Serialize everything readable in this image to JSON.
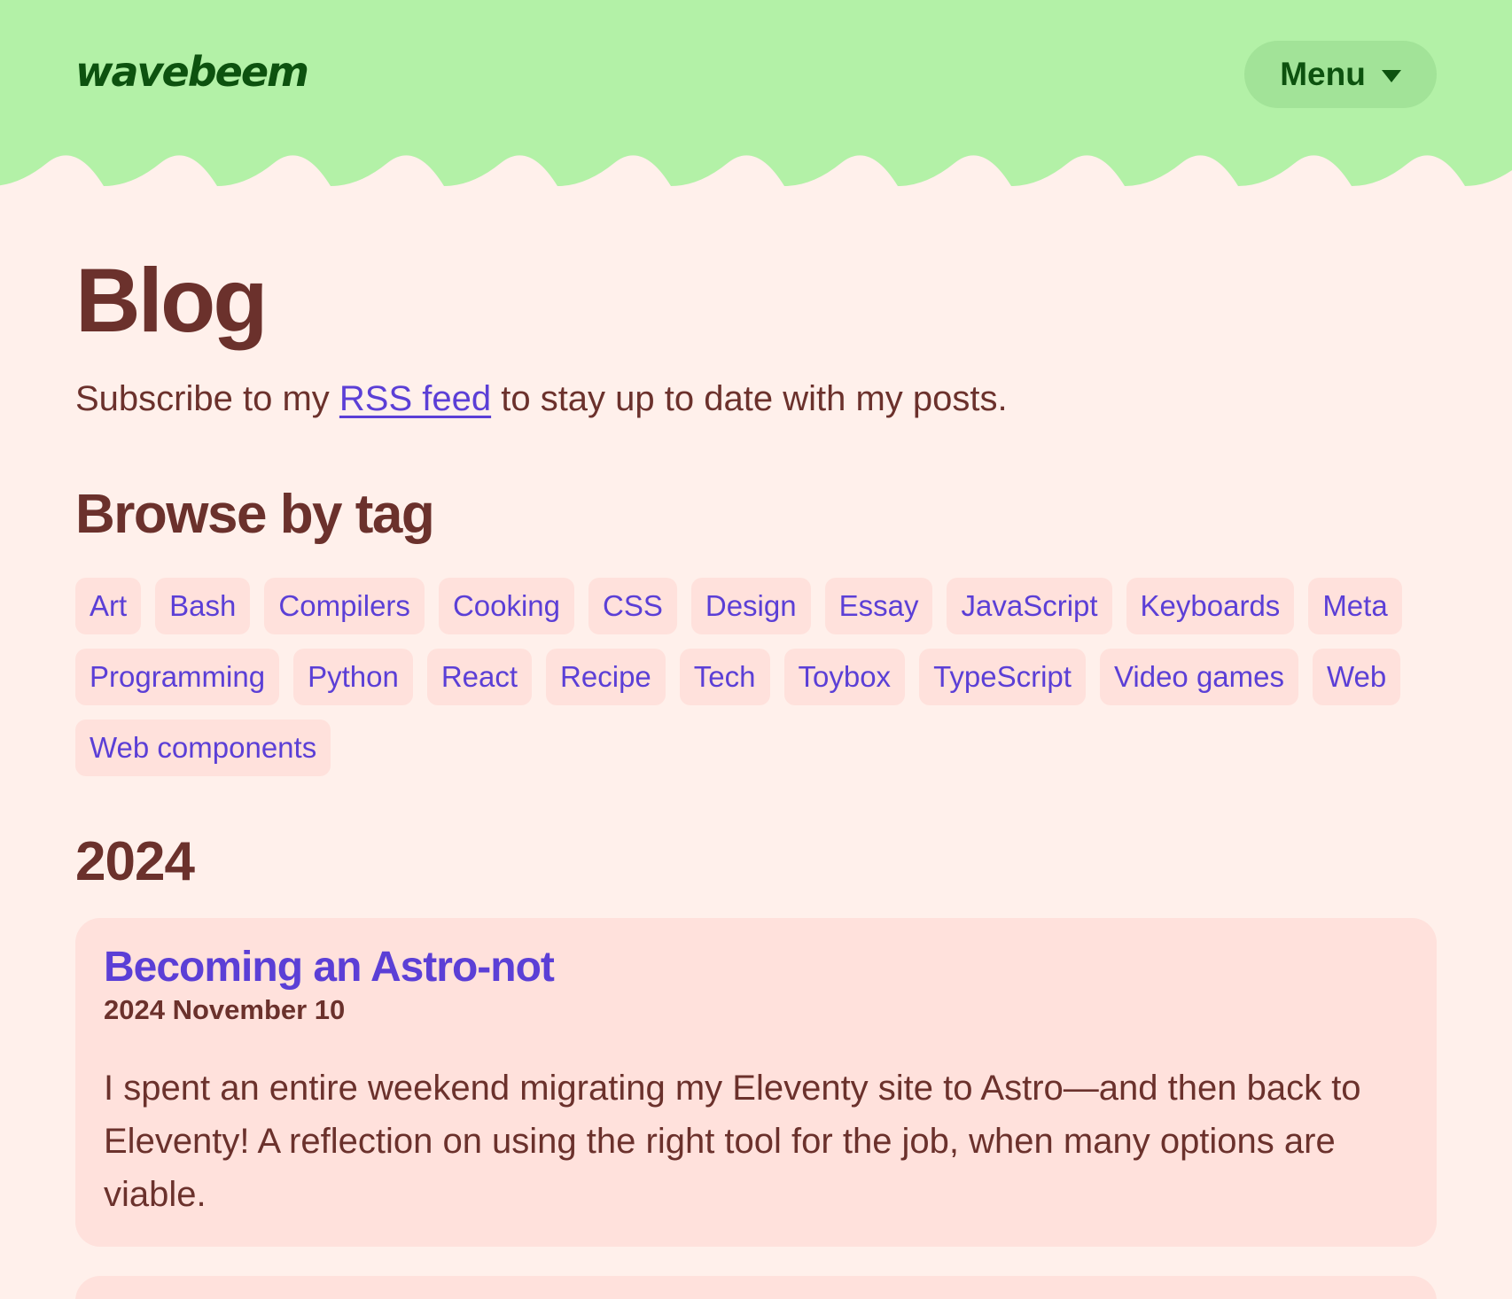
{
  "header": {
    "logo_text": "wavebeem",
    "menu_label": "Menu",
    "background_color": "#b3f1a7",
    "accent_color": "#0d520f"
  },
  "page": {
    "title": "Blog",
    "subscribe_before": "Subscribe to my ",
    "subscribe_link": "RSS feed",
    "subscribe_after": " to stay up to date with my posts.",
    "background_color": "#fff0eb",
    "text_color": "#6b312c",
    "link_color": "#5b3fd6"
  },
  "tags_section": {
    "heading": "Browse by tag",
    "tags": [
      "Art",
      "Bash",
      "Compilers",
      "Cooking",
      "CSS",
      "Design",
      "Essay",
      "JavaScript",
      "Keyboards",
      "Meta",
      "Programming",
      "Python",
      "React",
      "Recipe",
      "Tech",
      "Toybox",
      "TypeScript",
      "Video games",
      "Web",
      "Web components"
    ]
  },
  "year_section": {
    "year": "2024",
    "posts": [
      {
        "title": "Becoming an Astro-not",
        "date": "2024 November 10",
        "excerpt": "I spent an entire weekend migrating my Eleventy site to Astro—and then back to Eleventy! A reflection on using the right tool for the job, when many options are viable."
      }
    ]
  }
}
